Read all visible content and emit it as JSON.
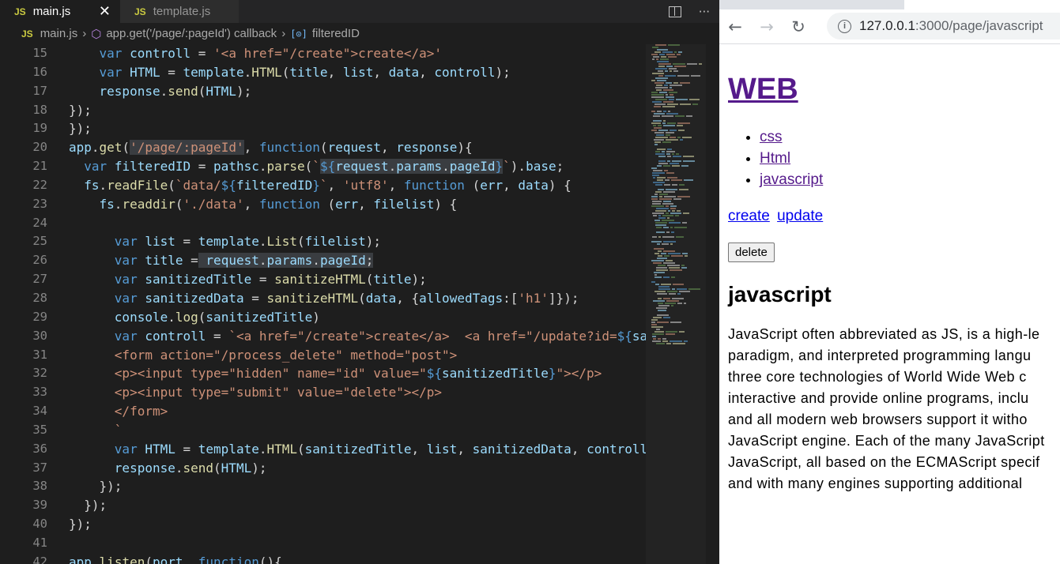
{
  "editor": {
    "tabs": [
      {
        "badge": "JS",
        "label": "main.js",
        "active": true
      },
      {
        "badge": "JS",
        "label": "template.js",
        "active": false
      }
    ],
    "tab_close": "✕",
    "more_actions": "···",
    "breadcrumb": {
      "file_badge": "JS",
      "file": "main.js",
      "callback": "app.get('/page/:pageId') callback",
      "variable": "filteredID"
    },
    "line_numbers": [
      "15",
      "16",
      "17",
      "18",
      "19",
      "20",
      "21",
      "22",
      "23",
      "24",
      "25",
      "26",
      "27",
      "28",
      "29",
      "30",
      "31",
      "32",
      "33",
      "34",
      "35",
      "36",
      "37",
      "38",
      "39",
      "40",
      "41",
      "42"
    ]
  },
  "browser": {
    "nav": {
      "back": "←",
      "forward": "→",
      "reload": "↻"
    },
    "url_host": "127.0.0.1",
    "url_path": ":3000/page/javascript",
    "page": {
      "title": "WEB",
      "list": [
        "css",
        "Html",
        "javascript"
      ],
      "create_link": "create",
      "update_link": "update",
      "delete_button": "delete",
      "heading": "javascript",
      "description_lines": [
        "JavaScript often abbreviated as JS, is a high-le",
        "paradigm, and interpreted programming langu",
        "three core technologies of World Wide Web c",
        "interactive and provide online programs, inclu",
        "and all modern web browsers support it witho",
        "JavaScript engine. Each of the many JavaScript",
        "JavaScript, all based on the ECMAScript specif",
        "and with many engines supporting additional"
      ]
    }
  }
}
